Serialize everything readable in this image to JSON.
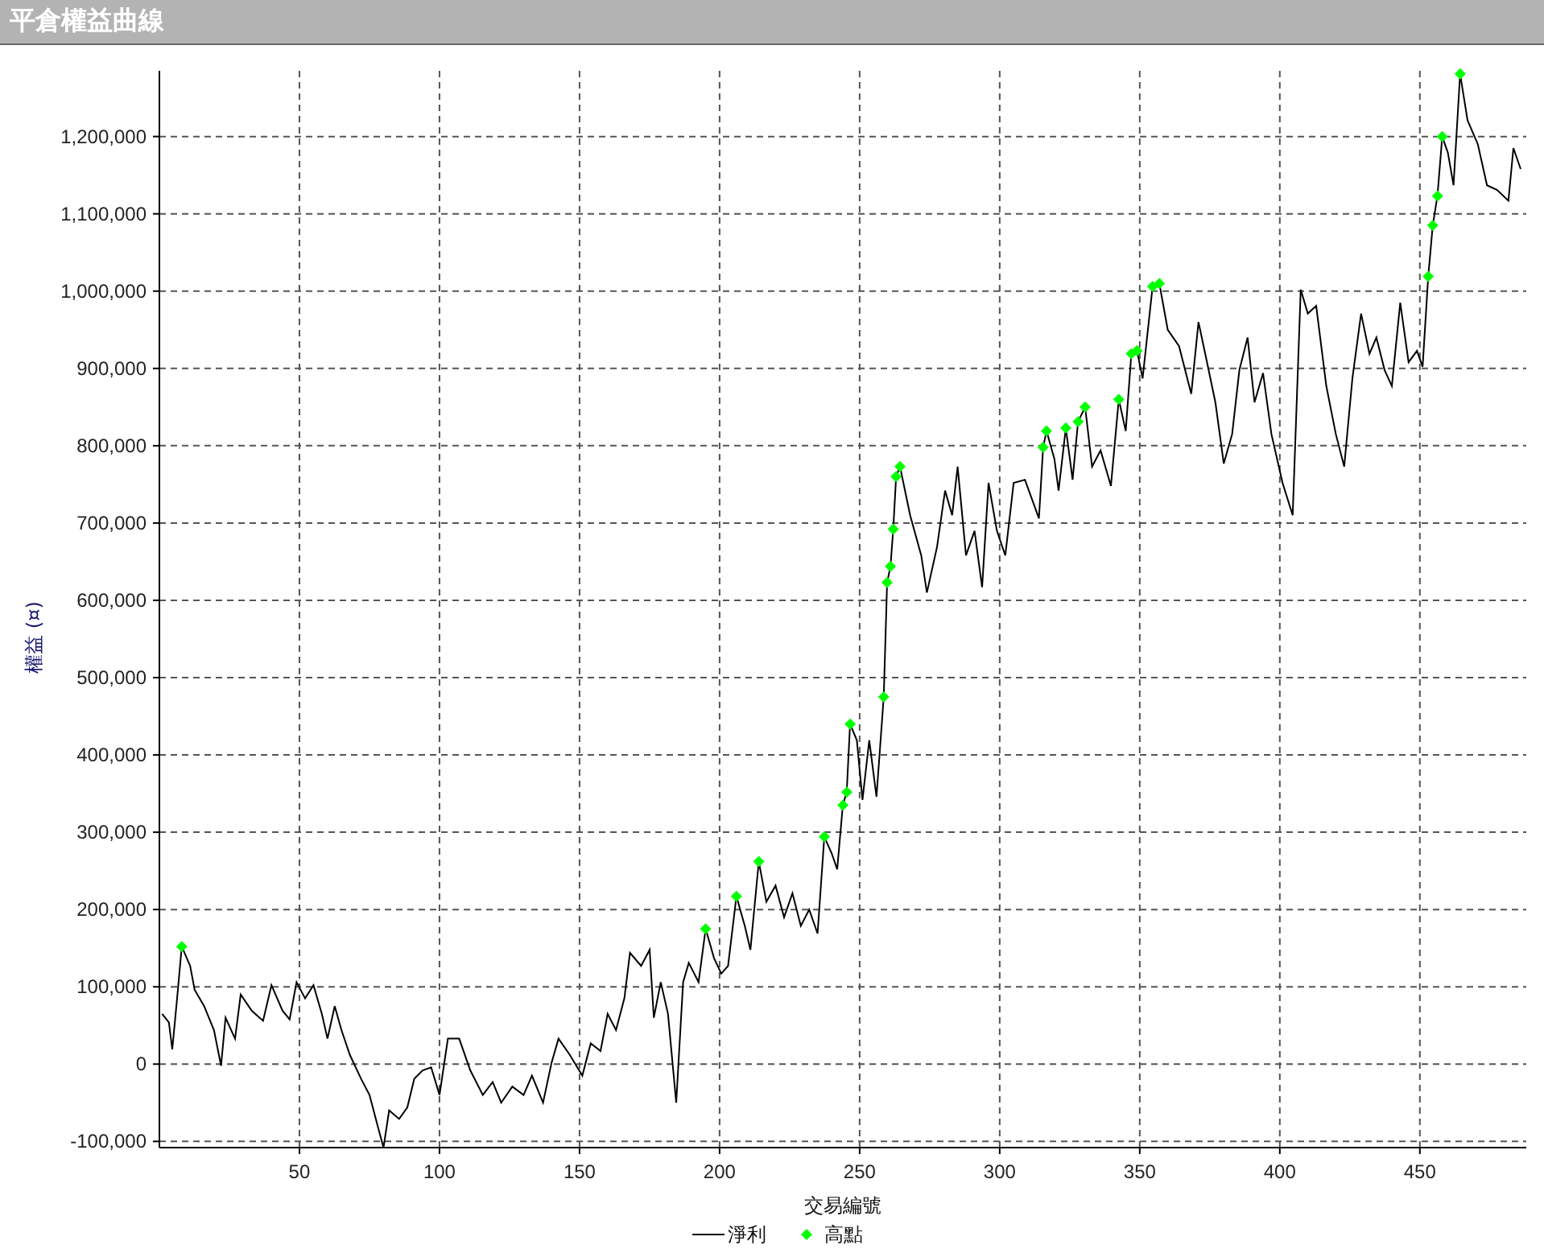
{
  "window": {
    "title": "平倉權益曲線"
  },
  "chart": {
    "chart_data": {
      "type": "line",
      "xlabel": "交易編號",
      "ylabel": "權益 (¤)",
      "xlim": [
        0,
        488
      ],
      "ylim": [
        -108000,
        1285000
      ],
      "grid": true,
      "legend": "bottom",
      "xticks": [
        50,
        100,
        150,
        200,
        250,
        300,
        350,
        400,
        450
      ],
      "yticks": [
        {
          "value": -100000,
          "label": "-100,000"
        },
        {
          "value": 0,
          "label": "0"
        },
        {
          "value": 100000,
          "label": "100,000"
        },
        {
          "value": 200000,
          "label": "200,000"
        },
        {
          "value": 300000,
          "label": "300,000"
        },
        {
          "value": 400000,
          "label": "400,000"
        },
        {
          "value": 500000,
          "label": "500,000"
        },
        {
          "value": 600000,
          "label": "600,000"
        },
        {
          "value": 700000,
          "label": "700,000"
        },
        {
          "value": 800000,
          "label": "800,000"
        },
        {
          "value": 900000,
          "label": "900,000"
        },
        {
          "value": 1000000,
          "label": "1,000,000"
        },
        {
          "value": 1100000,
          "label": "1,100,000"
        },
        {
          "value": 1200000,
          "label": "1,200,000"
        }
      ],
      "series": [
        {
          "name": "淨利",
          "color": "#000000",
          "type": "line",
          "x": [
            1,
            3.4,
            4.6,
            6.3,
            8,
            11,
            12.6,
            16,
            19.5,
            22,
            23.6,
            27,
            29,
            33,
            37,
            40,
            44,
            46.5,
            49,
            52,
            55,
            58,
            60,
            62.6,
            65,
            68,
            72,
            75,
            78,
            80,
            82,
            85.6,
            88.5,
            91,
            94,
            97,
            100,
            103,
            107,
            111,
            115.5,
            119,
            122,
            126,
            130,
            133,
            137,
            140,
            142.5,
            146.5,
            151,
            154,
            157.5,
            160,
            163,
            166,
            168,
            172,
            175,
            176.5,
            179,
            181.6,
            184.5,
            187,
            189,
            192.5,
            195,
            198,
            200.6,
            203,
            206,
            209,
            211,
            214,
            216.7,
            220,
            223,
            226,
            229,
            232,
            235,
            237.4,
            240,
            242,
            244,
            245.4,
            246.6,
            249,
            251,
            253.4,
            256,
            258.6,
            259.8,
            261,
            262,
            263,
            264.4,
            268,
            272,
            274,
            277.6,
            280.5,
            283,
            285,
            288,
            291,
            293.7,
            296,
            299,
            302,
            305,
            309,
            314,
            315.5,
            316.7,
            319.5,
            321,
            323.6,
            326,
            328,
            330.5,
            333,
            336,
            339.7,
            342.5,
            345,
            347,
            349,
            351,
            354.6,
            357,
            360,
            364,
            368.4,
            371,
            374,
            377,
            380,
            383,
            385.6,
            388.5,
            391,
            394,
            397,
            401,
            404.6,
            407.5,
            410,
            413,
            416.6,
            420,
            423,
            425.9,
            429,
            432,
            434.5,
            437.4,
            440,
            443,
            446,
            449,
            451,
            453,
            454.6,
            456.3,
            458,
            460,
            462,
            464.4,
            467,
            470.7,
            474,
            477.6,
            481.6,
            483.4,
            486
          ],
          "values": [
            65000,
            54000,
            19000,
            85000,
            152000,
            127000,
            96000,
            75000,
            44000,
            -2000,
            60000,
            33000,
            90000,
            69000,
            56000,
            102000,
            69000,
            58000,
            106000,
            85000,
            102000,
            65000,
            33000,
            75000,
            44000,
            12000,
            -19000,
            -40000,
            -81000,
            -108000,
            -60000,
            -71000,
            -56000,
            -19000,
            -8000,
            -4000,
            -40000,
            33000,
            33000,
            -8000,
            -40000,
            -23000,
            -50000,
            -29000,
            -40000,
            -15000,
            -50000,
            2000,
            33000,
            12000,
            -15000,
            27000,
            17000,
            65000,
            44000,
            85000,
            144000,
            127000,
            148000,
            60000,
            106000,
            65000,
            -50000,
            106000,
            131000,
            106000,
            175000,
            137000,
            117000,
            127000,
            217000,
            179000,
            148000,
            262000,
            210000,
            231000,
            190000,
            221000,
            179000,
            200000,
            169000,
            294000,
            273000,
            252000,
            335000,
            352000,
            440000,
            419000,
            342000,
            419000,
            346000,
            475000,
            623000,
            644000,
            692000,
            760000,
            773000,
            710000,
            658000,
            610000,
            669000,
            742000,
            710000,
            773000,
            658000,
            690000,
            617000,
            752000,
            690000,
            658000,
            752000,
            756000,
            706000,
            798000,
            819000,
            783000,
            742000,
            823000,
            756000,
            831000,
            850000,
            773000,
            794000,
            748000,
            860000,
            819000,
            919000,
            923000,
            887000,
            1006000,
            1010000,
            950000,
            929000,
            867000,
            960000,
            908000,
            856000,
            777000,
            815000,
            898000,
            940000,
            856000,
            894000,
            815000,
            752000,
            710000,
            1002000,
            971000,
            981000,
            877000,
            815000,
            773000,
            887000,
            971000,
            919000,
            940000,
            898000,
            877000,
            985000,
            908000,
            923000,
            902000,
            1019000,
            1085000,
            1123000,
            1200000,
            1179000,
            1137000,
            1281000,
            1221000,
            1190000,
            1137000,
            1131000,
            1117000,
            1185000,
            1158000
          ]
        },
        {
          "name": "高點",
          "color": "#00ff00",
          "type": "scatter",
          "x": [
            8,
            195,
            206,
            214,
            237.4,
            244,
            245.4,
            246.6,
            258.6,
            259.8,
            261,
            262,
            263,
            264.4,
            315.5,
            316.7,
            323.6,
            328,
            330.5,
            342.5,
            347,
            349,
            354.6,
            357,
            453,
            454.6,
            456.3,
            458,
            464.4
          ],
          "values": [
            152000,
            175000,
            217000,
            262000,
            294000,
            335000,
            352000,
            440000,
            475000,
            623000,
            644000,
            692000,
            760000,
            773000,
            798000,
            819000,
            823000,
            831000,
            850000,
            860000,
            919000,
            923000,
            1006000,
            1010000,
            1019000,
            1085000,
            1123000,
            1200000,
            1281000
          ]
        }
      ]
    }
  }
}
